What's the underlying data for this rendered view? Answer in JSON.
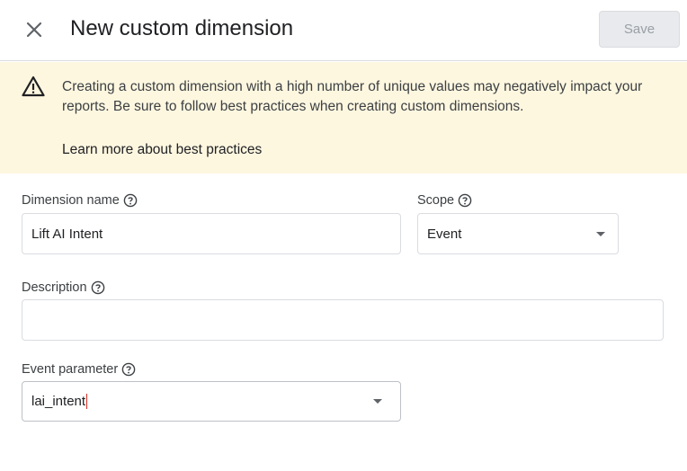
{
  "header": {
    "title": "New custom dimension",
    "save_label": "Save"
  },
  "banner": {
    "message": "Creating a custom dimension with a high number of unique values may negatively impact your reports. Be sure to follow best practices when creating custom dimensions.",
    "link_label": "Learn more about best practices"
  },
  "form": {
    "dimension_name": {
      "label": "Dimension name",
      "value": "Lift AI Intent"
    },
    "scope": {
      "label": "Scope",
      "value": "Event"
    },
    "description": {
      "label": "Description",
      "value": ""
    },
    "event_parameter": {
      "label": "Event parameter",
      "value": "lai_intent"
    }
  },
  "colors": {
    "banner_bg": "#fef7e0",
    "save_disabled_bg": "#e8eaed",
    "cursor": "#d93025"
  }
}
